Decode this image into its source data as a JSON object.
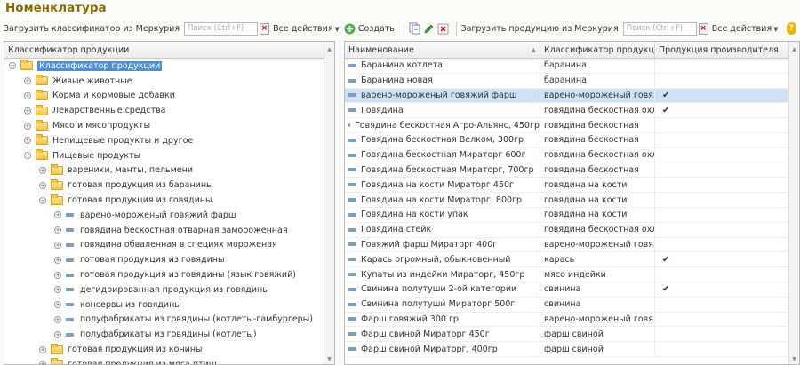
{
  "page": {
    "title": "Номенклатура"
  },
  "toolbar": {
    "load_classifier_label": "Загрузить классификатор из Меркурия",
    "search_placeholder_left": "Поиск (Ctrl+F)",
    "all_actions_left": "Все действия",
    "create_label": "Создать",
    "load_products_label": "Загрузить продукцию из Меркурия",
    "search_placeholder_right": "Поиск (Ctrl+F)",
    "all_actions_right": "Все действия",
    "help": "?"
  },
  "tree": {
    "header": "Классификатор продукции",
    "rows": [
      {
        "level": 0,
        "expander": "−",
        "kind": "folder",
        "label": "Классификатор продукции",
        "selected": true
      },
      {
        "level": 1,
        "expander": "+",
        "kind": "folder",
        "label": "Живые животные"
      },
      {
        "level": 1,
        "expander": "+",
        "kind": "folder",
        "label": "Корма и кормовые добавки"
      },
      {
        "level": 1,
        "expander": "+",
        "kind": "folder",
        "label": "Лекарственные средства"
      },
      {
        "level": 1,
        "expander": "+",
        "kind": "folder",
        "label": "Мясо и мясопродукты"
      },
      {
        "level": 1,
        "expander": "+",
        "kind": "folder",
        "label": "Непищевые продукты и другое"
      },
      {
        "level": 1,
        "expander": "−",
        "kind": "folder",
        "label": "Пищевые продукты"
      },
      {
        "level": 2,
        "expander": "+",
        "kind": "folder",
        "label": "вареники, манты, пельмени"
      },
      {
        "level": 2,
        "expander": "+",
        "kind": "folder",
        "label": "готовая продукция из баранины"
      },
      {
        "level": 2,
        "expander": "−",
        "kind": "folder",
        "label": "готовая продукция из говядины"
      },
      {
        "level": 3,
        "expander": "+",
        "kind": "item",
        "label": "варено-мороженый говяжий фарш"
      },
      {
        "level": 3,
        "expander": "+",
        "kind": "item",
        "label": "говядина бескостная отварная замороженная"
      },
      {
        "level": 3,
        "expander": "+",
        "kind": "item",
        "label": "говядина обваленная в специях мороженая"
      },
      {
        "level": 3,
        "expander": "+",
        "kind": "item",
        "label": "готовая продукция из говядины"
      },
      {
        "level": 3,
        "expander": "+",
        "kind": "item",
        "label": "готовая продукция из говядины (язык говяжий)"
      },
      {
        "level": 3,
        "expander": "+",
        "kind": "item",
        "label": "дегидрированная продукция из говядины"
      },
      {
        "level": 3,
        "expander": "+",
        "kind": "item",
        "label": "консервы из говядины"
      },
      {
        "level": 3,
        "expander": "+",
        "kind": "item",
        "label": "полуфабрикаты из говядины (котлеты-гамбургеры)"
      },
      {
        "level": 3,
        "expander": "+",
        "kind": "item",
        "label": "полуфабрикаты из говядины (котлеты)"
      },
      {
        "level": 2,
        "expander": "+",
        "kind": "folder",
        "label": "готовая продукция из конины"
      },
      {
        "level": 2,
        "expander": "+",
        "kind": "folder",
        "label": "готовая продукция из мяса птицы"
      }
    ]
  },
  "grid": {
    "columns": [
      "Наименование",
      "Классификатор продукции",
      "Продукция производителя"
    ],
    "check_mark": "✔",
    "rows": [
      {
        "name": "Баранина котлета",
        "classifier": "баранина",
        "producer": false
      },
      {
        "name": "Баранина новая",
        "classifier": "баранина",
        "producer": false
      },
      {
        "name": "варено-мороженый говяжий фарш",
        "classifier": "варено-мороженый говяж...",
        "producer": true,
        "selected": true
      },
      {
        "name": "Говядина",
        "classifier": "говядина бескостная охл...",
        "producer": true
      },
      {
        "name": "Говядина бескостная Агро-Альянс, 450гр",
        "classifier": "говядина бескостная",
        "producer": false
      },
      {
        "name": "Говядина бескостная Велком, 300гр",
        "classifier": "говядина бескостная",
        "producer": false
      },
      {
        "name": "Говядина бескостная Мираторг 600г",
        "classifier": "говядина бескостная охл...",
        "producer": false
      },
      {
        "name": "Говядина бескостная Мираторг, 700гр",
        "classifier": "говядина бескостная",
        "producer": false
      },
      {
        "name": "Говядина на кости Мираторг 450г",
        "classifier": "говядина на кости",
        "producer": false
      },
      {
        "name": "Говядина на кости Мираторг, 800гр",
        "classifier": "говядина на кости",
        "producer": false
      },
      {
        "name": "Говядина на кости упак",
        "classifier": "говядина на кости",
        "producer": false
      },
      {
        "name": "Говядина стейк",
        "classifier": "говядина бескостная охл...",
        "producer": false
      },
      {
        "name": "Говяжий фарш Мираторг 400г",
        "classifier": "варено-мороженый говяж...",
        "producer": false
      },
      {
        "name": "Карась огромный, обыкновенный",
        "classifier": "карась",
        "producer": true
      },
      {
        "name": "Купаты из индейки Мираторг, 450гр",
        "classifier": "мясо индейки",
        "producer": false
      },
      {
        "name": "Свинина полутуши 2-ой категории",
        "classifier": "свинина",
        "producer": true
      },
      {
        "name": "Свинина полутуши Мираторг 500г",
        "classifier": "свинина",
        "producer": false
      },
      {
        "name": "Фарш говяжий 300 гр",
        "classifier": "варено-мороженый говяж...",
        "producer": false
      },
      {
        "name": "Фарш свиной Мираторг 450г",
        "classifier": "фарш свиной",
        "producer": false
      },
      {
        "name": "Фарш свиной Мираторг, 400гр",
        "classifier": "фарш свиной",
        "producer": false
      }
    ]
  }
}
